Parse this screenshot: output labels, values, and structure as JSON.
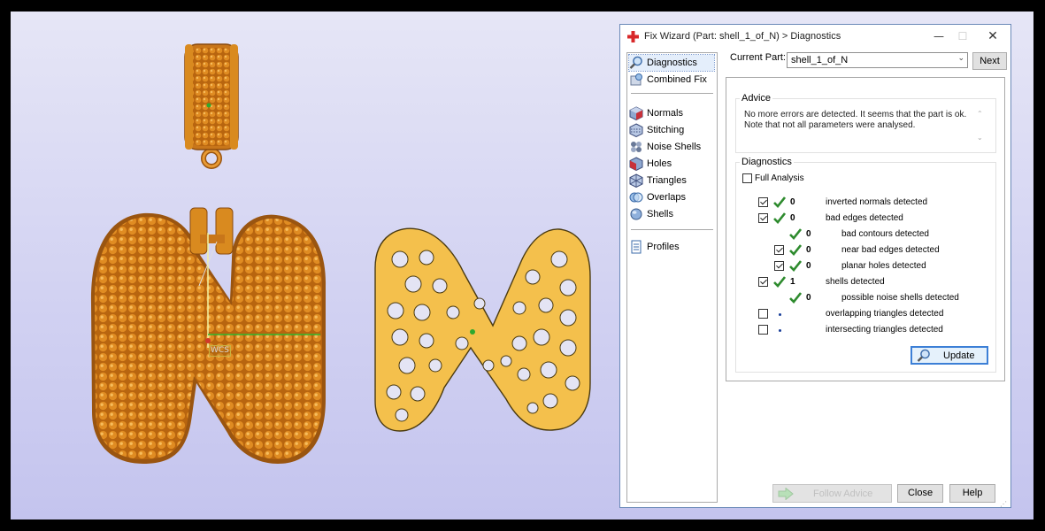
{
  "window": {
    "title": "Fix Wizard (Part: shell_1_of_N) > Diagnostics"
  },
  "viewport": {
    "wcs_label": "WCS",
    "part_color": "#d98a1f",
    "mesh_color": "#f4c04c"
  },
  "nav": {
    "items": [
      {
        "label": "Diagnostics",
        "icon": "magnifier-icon"
      },
      {
        "label": "Combined Fix",
        "icon": "combined-fix-icon"
      },
      {
        "label": "Normals",
        "icon": "normals-cube-icon"
      },
      {
        "label": "Stitching",
        "icon": "stitching-icon"
      },
      {
        "label": "Noise Shells",
        "icon": "noise-shells-icon"
      },
      {
        "label": "Holes",
        "icon": "holes-cube-icon"
      },
      {
        "label": "Triangles",
        "icon": "triangles-cube-icon"
      },
      {
        "label": "Overlaps",
        "icon": "overlaps-icon"
      },
      {
        "label": "Shells",
        "icon": "shells-icon"
      },
      {
        "label": "Profiles",
        "icon": "profiles-document-icon"
      }
    ]
  },
  "current_part": {
    "label": "Current Part:",
    "value": "shell_1_of_N",
    "next_label": "Next"
  },
  "advice": {
    "title": "Advice",
    "line1": "No more errors are detected. It seems that the part is ok.",
    "line2": "Note that not all parameters were analysed."
  },
  "diagnostics": {
    "title": "Diagnostics",
    "full_analysis_label": "Full Analysis",
    "rows": [
      {
        "label": "inverted normals detected",
        "count": "0",
        "checked": true,
        "status": "ok"
      },
      {
        "label": "bad edges detected",
        "count": "0",
        "checked": true,
        "status": "ok"
      },
      {
        "label": "bad contours detected",
        "count": "0",
        "checked": false,
        "status": "ok"
      },
      {
        "label": "near bad edges detected",
        "count": "0",
        "checked": true,
        "status": "ok"
      },
      {
        "label": "planar holes detected",
        "count": "0",
        "checked": true,
        "status": "ok"
      },
      {
        "label": "shells detected",
        "count": "1",
        "checked": true,
        "status": "ok"
      },
      {
        "label": "possible noise shells detected",
        "count": "0",
        "checked": false,
        "status": "ok"
      },
      {
        "label": "overlapping triangles detected",
        "count": "",
        "checked": false,
        "status": "not-run"
      },
      {
        "label": "intersecting triangles detected",
        "count": "",
        "checked": false,
        "status": "not-run"
      }
    ],
    "update_label": "Update"
  },
  "footer": {
    "follow_advice_label": "Follow Advice",
    "close_label": "Close",
    "help_label": "Help"
  },
  "colors": {
    "tick_green": "#2e8b2e",
    "selection_border": "#3c7fd6",
    "window_border": "#6b8ab8"
  }
}
